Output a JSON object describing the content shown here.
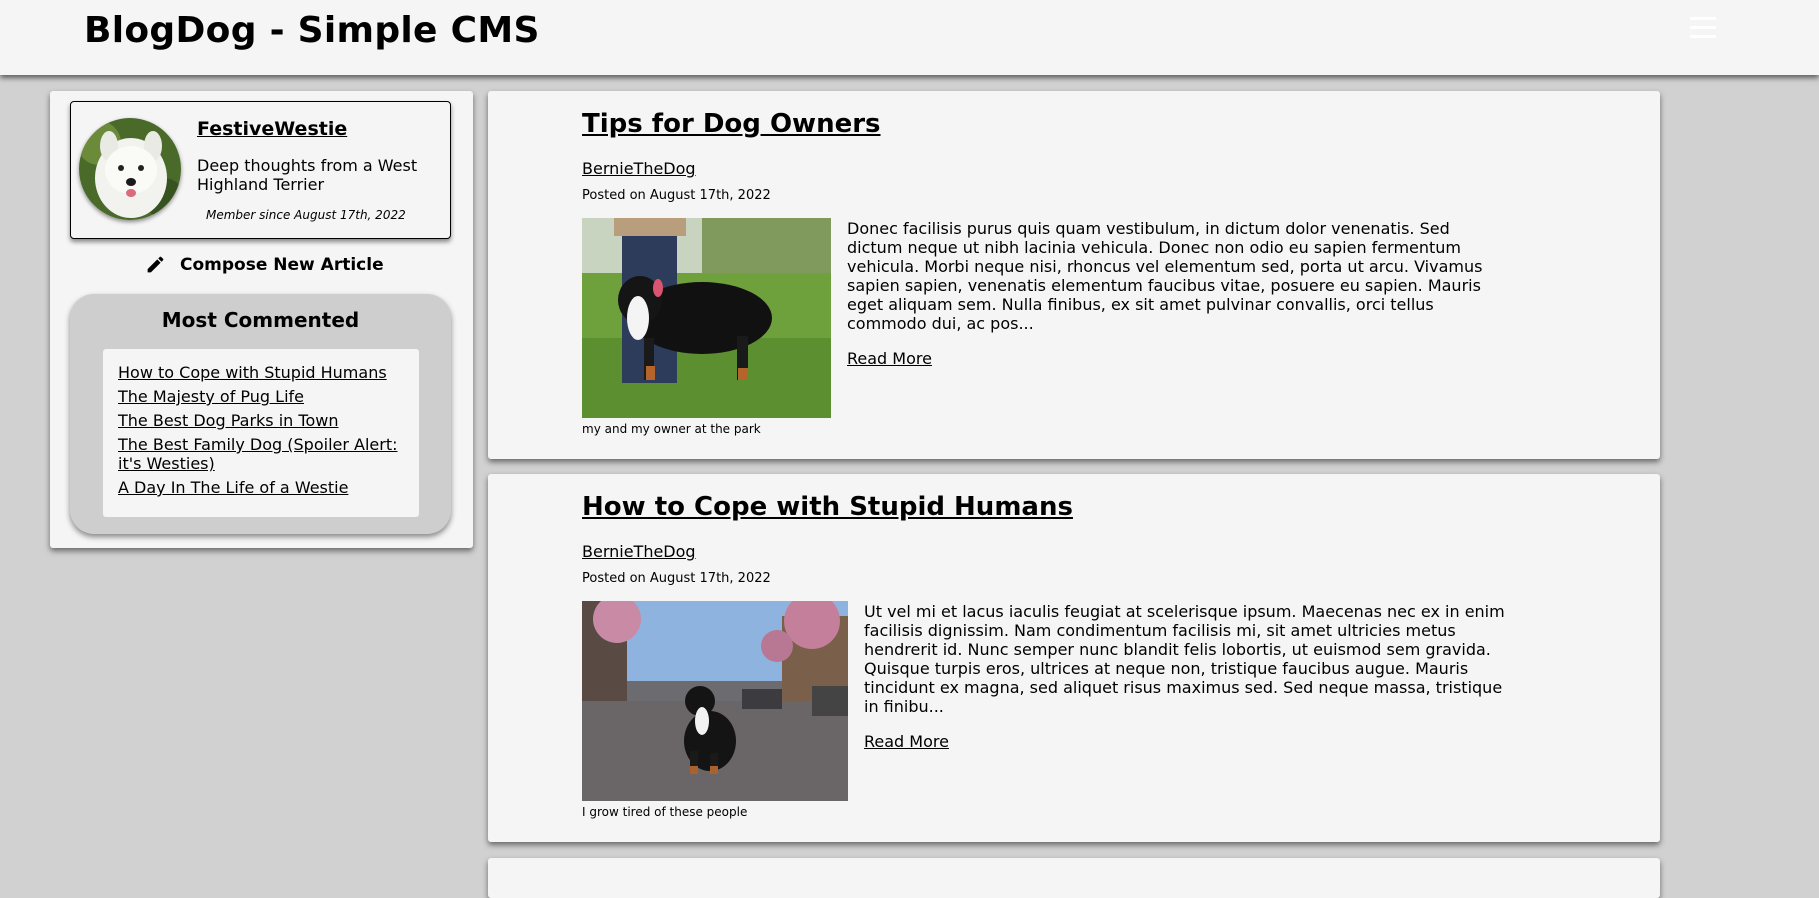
{
  "header": {
    "title": "BlogDog - Simple CMS"
  },
  "profile": {
    "name": "FestiveWestie",
    "bio": "Deep thoughts from a West Highland Terrier",
    "member_since": "Member since August 17th, 2022"
  },
  "compose": {
    "label": "Compose New Article",
    "icon": "pencil-icon"
  },
  "most_commented": {
    "title": "Most Commented",
    "items": [
      "How to Cope with Stupid Humans",
      "The Majesty of Pug Life",
      "The Best Dog Parks in Town",
      "The Best Family Dog (Spoiler Alert: it's Westies)",
      "A Day In The Life of a Westie"
    ]
  },
  "articles": [
    {
      "title": "Tips for Dog Owners",
      "author": "BernieTheDog",
      "date": "Posted on August 17th, 2022",
      "caption": "my and my owner at the park",
      "excerpt": "Donec facilisis purus quis quam vestibulum, in dictum dolor venenatis. Sed dictum neque ut nibh lacinia vehicula. Donec non odio eu sapien fermentum vehicula. Morbi neque nisi, rhoncus vel elementum sed, porta ut arcu. Vivamus sapien sapien, venenatis elementum faucibus vitae, posuere eu sapien. Mauris eget aliquam sem. Nulla finibus, ex sit amet pulvinar convallis, orci tellus commodo dui, ac pos...",
      "read_more": "Read More"
    },
    {
      "title": "How to Cope with Stupid Humans",
      "author": "BernieTheDog",
      "date": "Posted on August 17th, 2022",
      "caption": "I grow tired of these people",
      "excerpt": "Ut vel mi et lacus iaculis feugiat at scelerisque ipsum. Maecenas nec ex in enim facilisis dignissim. Nam condimentum facilisis mi, sit amet ultricies metus hendrerit id. Nunc semper nunc blandit felis lobortis, ut euismod sem gravida. Quisque turpis eros, ultrices at neque non, tristique faucibus augue. Mauris tincidunt ex magna, sed aliquet risus maximus sed. Sed neque massa, tristique in finibu...",
      "read_more": "Read More"
    }
  ]
}
